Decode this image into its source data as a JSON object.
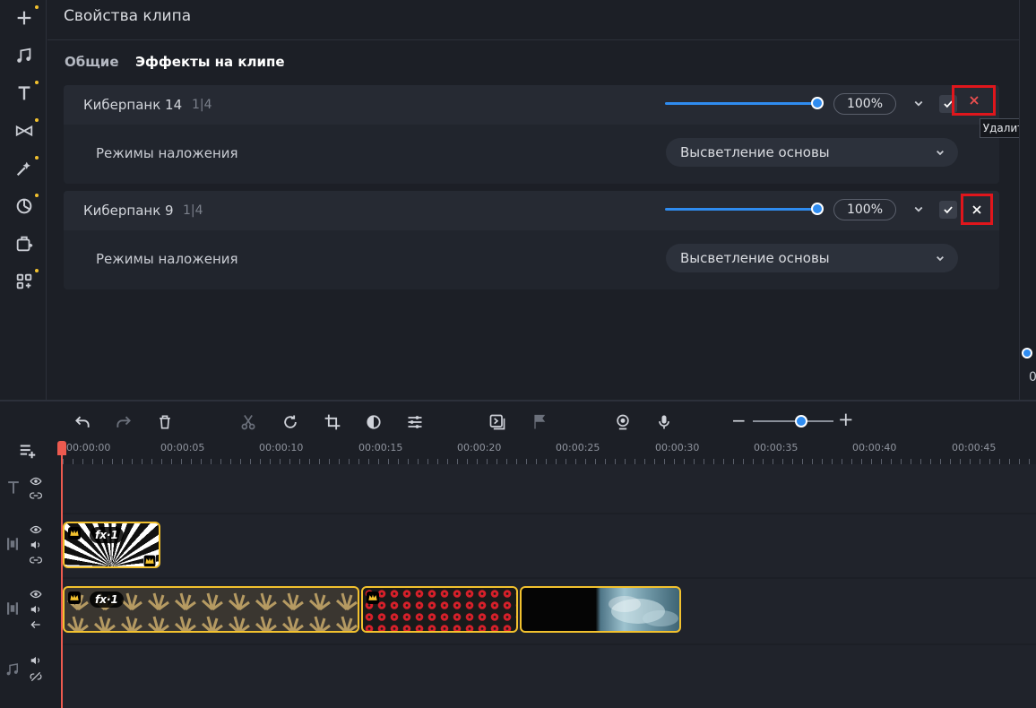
{
  "panel": {
    "title": "Свойства клипа",
    "tabs": [
      "Общие",
      "Эффекты на клипе"
    ],
    "active_tab": "Эффекты на клипе"
  },
  "effects": [
    {
      "name": "Киберпанк 14",
      "count": "1|4",
      "opacity": "100%",
      "opacity_value": 100,
      "enabled": true,
      "blend_label": "Режимы наложения",
      "blend_value": "Высветление основы"
    },
    {
      "name": "Киберпанк 9",
      "count": "1|4",
      "opacity": "100%",
      "opacity_value": 100,
      "enabled": true,
      "blend_label": "Режимы наложения",
      "blend_value": "Высветление основы"
    }
  ],
  "tooltip": "Удалить",
  "right_strip_value": "0",
  "toolbar_left_icons": [
    "add-icon",
    "music-icon",
    "text-icon",
    "transitions-icon",
    "magic-wand-icon",
    "stickers-icon",
    "media-icon",
    "more-tools-icon"
  ],
  "timeline": {
    "tools": [
      "undo-icon",
      "redo-icon",
      "trash-icon",
      "scissors-icon",
      "rotate-icon",
      "crop-icon",
      "color-adjust-icon",
      "equalizer-icon",
      "insert-icon",
      "flag-icon",
      "webcam-icon",
      "microphone-icon"
    ],
    "ruler": [
      "00:00:00",
      "00:00:05",
      "00:00:10",
      "00:00:15",
      "00:00:20",
      "00:00:25",
      "00:00:30",
      "00:00:35",
      "00:00:40",
      "00:00:45"
    ],
    "clips": [
      {
        "track": "overlay",
        "fx": "fx·1"
      },
      {
        "track": "main",
        "fx": "fx·1"
      },
      {
        "track": "main"
      },
      {
        "track": "main"
      }
    ]
  },
  "colors": {
    "accent": "#2f8cf0",
    "clip_border": "#f2c12e",
    "playhead": "#ec5a4f",
    "highlight": "#e0161c"
  }
}
